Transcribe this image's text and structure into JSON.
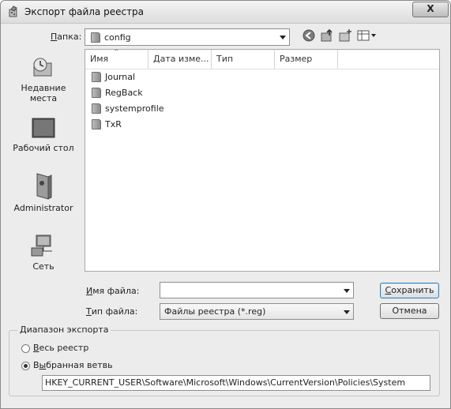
{
  "window": {
    "title": "Экспорт файла реестра",
    "close_glyph": "X"
  },
  "lookin": {
    "label_prefix": "",
    "label_underlined": "П",
    "label_rest": "апка:",
    "value": "config"
  },
  "toolbar": {
    "icons": [
      "back-icon",
      "up-folder-icon",
      "new-folder-icon",
      "views-menu-icon"
    ]
  },
  "places": [
    {
      "label_line1": "Недавние",
      "label_line2": "места",
      "icon": "recent-places-icon"
    },
    {
      "label_line1": "Рабочий стол",
      "label_line2": "",
      "icon": "desktop-icon"
    },
    {
      "label_line1": "Administrator",
      "label_line2": "",
      "icon": "user-folder-icon"
    },
    {
      "label_line1": "Сеть",
      "label_line2": "",
      "icon": "network-icon"
    }
  ],
  "filelist": {
    "columns": [
      "Имя",
      "Дата изме...",
      "Тип",
      "Размер"
    ],
    "items": [
      "Journal",
      "RegBack",
      "systemprofile",
      "TxR"
    ]
  },
  "filename": {
    "label_underlined": "И",
    "label_rest": "мя файла:",
    "value": ""
  },
  "filetype": {
    "label_underlined": "Т",
    "label_rest": "ип файла:",
    "value": "Файлы реестра (*.reg)"
  },
  "buttons": {
    "save_underlined": "С",
    "save_rest": "охранить",
    "cancel": "Отмена"
  },
  "export_range": {
    "legend": "Диапазон экспорта",
    "opt_all_underlined": "В",
    "opt_all_rest": "есь реестр",
    "opt_branch_underlined": "ы",
    "opt_branch_prefix": "В",
    "opt_branch_rest": "бранная ветвь",
    "selected": "branch",
    "path": "HKEY_CURRENT_USER\\Software\\Microsoft\\Windows\\CurrentVersion\\Policies\\System"
  }
}
